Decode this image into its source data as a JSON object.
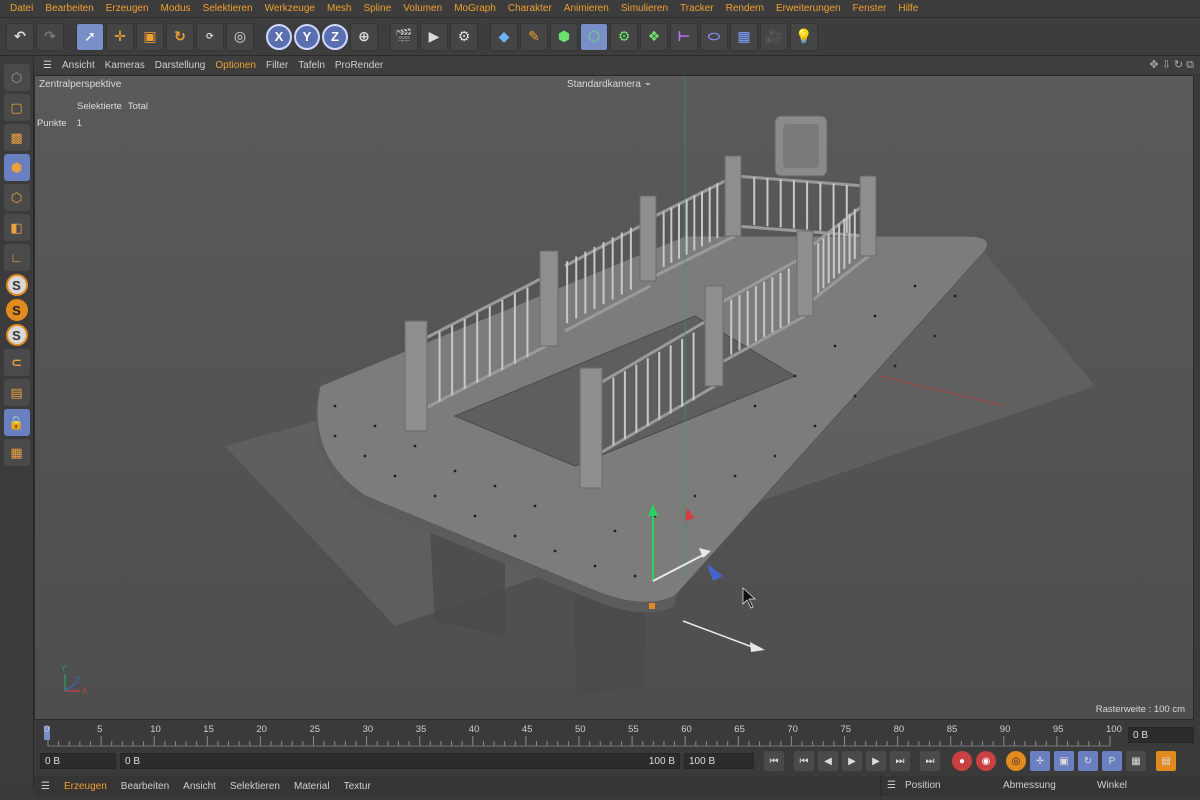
{
  "menubar": [
    "Datei",
    "Bearbeiten",
    "Erzeugen",
    "Modus",
    "Selektieren",
    "Werkzeuge",
    "Mesh",
    "Spline",
    "Volumen",
    "MoGraph",
    "Charakter",
    "Animieren",
    "Simulieren",
    "Tracker",
    "Rendern",
    "Erweiterungen",
    "Fenster",
    "Hilfe"
  ],
  "toolbar": {
    "axis_x": "X",
    "axis_y": "Y",
    "axis_z": "Z"
  },
  "viewport_menu": [
    "Ansicht",
    "Kameras",
    "Darstellung",
    "Optionen",
    "Filter",
    "Tafeln",
    "ProRender"
  ],
  "viewport": {
    "view_name": "Zentralperspektive",
    "camera_name": "Standardkamera",
    "stats_header_selected": "Selektierte",
    "stats_header_total": "Total",
    "stats_row_label": "Punkte",
    "stats_row_selected": "1",
    "grid_info": "Rasterweite : 100 cm",
    "axis_y": "Y",
    "axis_x": "X",
    "axis_z": "Z"
  },
  "timeline": {
    "ticks": [
      "0",
      "5",
      "10",
      "15",
      "20",
      "25",
      "30",
      "35",
      "40",
      "45",
      "50",
      "55",
      "60",
      "65",
      "70",
      "75",
      "80",
      "85",
      "90",
      "95",
      "100"
    ],
    "current_frame": "0 B"
  },
  "playbar": {
    "start_field": "0 B",
    "range_start": "0 B",
    "range_end": "100 B",
    "end_field": "100 B"
  },
  "bottom_menu": [
    "Erzeugen",
    "Bearbeiten",
    "Ansicht",
    "Selektieren",
    "Material",
    "Textur"
  ],
  "attribute_tabs": {
    "position": "Position",
    "size": "Abmessung",
    "angle": "Winkel"
  }
}
